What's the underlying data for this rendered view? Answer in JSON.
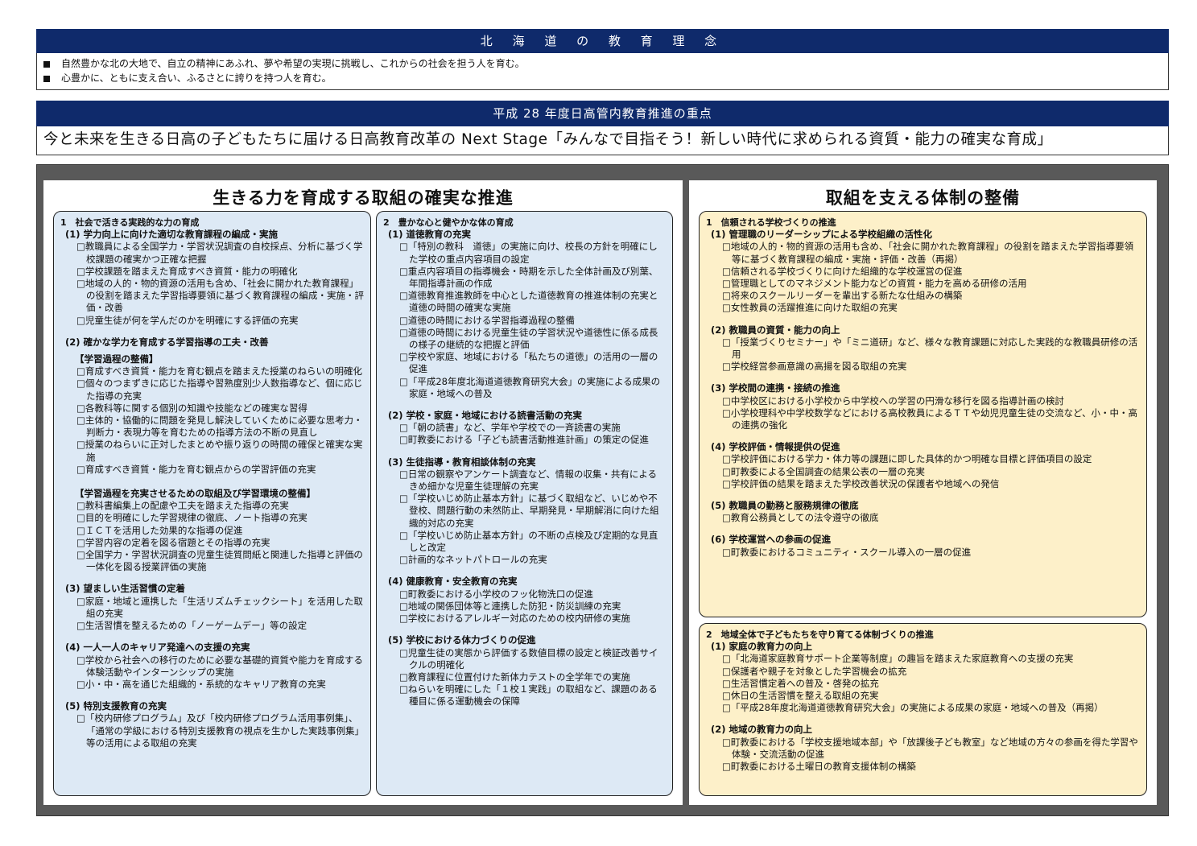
{
  "header": {
    "philosophy_title": "北 海 道 の 教 育 理 念",
    "philosophy_lines": [
      "自然豊かな北の大地で、自立の精神にあふれ、夢や希望の実現に挑戦し、これからの社会を担う人を育む。",
      "心豊かに、ともに支え合い、ふるさとに誇りを持つ人を育む。"
    ],
    "priority_title": "平成 28 年度日高管内教育推進の重点",
    "slogan": "今と未来を生きる日高の子どもたちに届ける日高教育改革の Next Stage「みんなで目指そう！新しい時代に求められる資質・能力の確実な育成」"
  },
  "left_panel": {
    "title": "生きる力を育成する取組の確実な推進",
    "col1": {
      "heading": "1　社会で活きる実践的な力の育成",
      "sections": [
        {
          "title": "(1) 学力向上に向けた適切な教育課程の編成・実施",
          "items": [
            "□教職員による全国学力・学習状況調査の自校採点、分析に基づく学校課題の確実かつ正確な把握",
            "□学校課題を踏まえた育成すべき資質・能力の明確化",
            "□地域の人的・物的資源の活用も含め、「社会に開かれた教育課程」の役割を踏まえた学習指導要領に基づく教育課程の編成・実施・評価・改善",
            "□児童生徒が何を学んだのかを明確にする評価の充実"
          ]
        },
        {
          "title": "(2) 確かな学力を育成する学習指導の工夫・改善",
          "sub": "【学習過程の整備】",
          "items": [
            "□育成すべき資質・能力を育む観点を踏まえた授業のねらいの明確化",
            "□個々のつまずきに応じた指導や習熟度別少人数指導など、個に応じた指導の充実",
            "□各教科等に関する個別の知識や技能などの確実な習得",
            "□主体的・協働的に問題を発見し解決していくために必要な思考力・判断力・表現力等を育むための指導方法の不断の見直し",
            "□授業のねらいに正対したまとめや振り返りの時間の確保と確実な実施",
            "□育成すべき資質・能力を育む観点からの学習評価の充実"
          ],
          "sub2": "【学習過程を充実させるための取組及び学習環境の整備】",
          "items2": [
            "□教科書編集上の配慮や工夫を踏まえた指導の充実",
            "□目的を明確にした学習規律の徹底、ノート指導の充実",
            "□ＩＣＴを活用した効果的な指導の促進",
            "□学習内容の定着を図る宿題とその指導の充実",
            "□全国学力・学習状況調査の児童生徒質問紙と関連した指導と評価の一体化を図る授業評価の実施"
          ]
        },
        {
          "title": "(3) 望ましい生活習慣の定着",
          "items": [
            "□家庭・地域と連携した「生活リズムチェックシート」を活用した取組の充実",
            "□生活習慣を整えるための「ノーゲームデー」等の設定"
          ]
        },
        {
          "title": "(4) 一人一人のキャリア発達への支援の充実",
          "items": [
            "□学校から社会への移行のために必要な基礎的資質や能力を育成する体験活動やインターンシップの実施",
            "□小・中・高を通じた組織的・系統的なキャリア教育の充実"
          ]
        },
        {
          "title": "(5) 特別支援教育の充実",
          "items": [
            "□「校内研修プログラム」及び「校内研修プログラム活用事例集」、「通常の学級における特別支援教育の視点を生かした実践事例集」等の活用による取組の充実"
          ]
        }
      ]
    },
    "col2": {
      "heading": "2　豊かな心と健やかな体の育成",
      "sections": [
        {
          "title": "(1) 道徳教育の充実",
          "items": [
            "□「特別の教科　道徳」の実施に向け、校長の方針を明確にした学校の重点内容項目の設定",
            "□重点内容項目の指導機会・時期を示した全体計画及び別葉、年間指導計画の作成",
            "□道徳教育推進教師を中心とした道徳教育の推進体制の充実と道徳の時間の確実な実施",
            "□道徳の時間における学習指導過程の整備",
            "□道徳の時間における児童生徒の学習状況や道徳性に係る成長の様子の継続的な把握と評価",
            "□学校や家庭、地域における「私たちの道徳」の活用の一層の促進",
            "□「平成28年度北海道道徳教育研究大会」の実施による成果の家庭・地域への普及"
          ]
        },
        {
          "title": "(2) 学校・家庭・地域における読書活動の充実",
          "items": [
            "□「朝の読書」など、学年や学校での一斉読書の実施",
            "□町教委における「子ども読書活動推進計画」の策定の促進"
          ]
        },
        {
          "title": "(3) 生徒指導・教育相談体制の充実",
          "items": [
            "□日常の観察やアンケート調査など、情報の収集・共有によるきめ細かな児童生徒理解の充実",
            "□「学校いじめ防止基本方針」に基づく取組など、いじめや不登校、問題行動の未然防止、早期発見・早期解消に向けた組織的対応の充実",
            "□「学校いじめ防止基本方針」の不断の点検及び定期的な見直しと改定",
            "□計画的なネットパトロールの充実"
          ]
        },
        {
          "title": "(4) 健康教育・安全教育の充実",
          "items": [
            "□町教委における小学校のフッ化物洗口の促進",
            "□地域の関係団体等と連携した防犯・防災訓練の充実",
            "□学校におけるアレルギー対応のための校内研修の実施"
          ]
        },
        {
          "title": "(5) 学校における体力づくりの促進",
          "items": [
            "□児童生徒の実態から評価する数値目標の設定と検証改善サイクルの明確化",
            "□教育課程に位置付けた新体力テストの全学年での実施",
            "□ねらいを明確にした「１校１実践」の取組など、課題のある種目に係る運動機会の保障"
          ]
        }
      ]
    }
  },
  "right_panel": {
    "title": "取組を支える体制の整備",
    "box1": {
      "heading": "1　信頼される学校づくりの推進",
      "sections": [
        {
          "title": "(1) 管理職のリーダーシップによる学校組織の活性化",
          "items": [
            "□地域の人的・物的資源の活用も含め、「社会に開かれた教育課程」の役割を踏まえた学習指導要領等に基づく教育課程の編成・実施・評価・改善（再掲）",
            "□信頼される学校づくりに向けた組織的な学校運営の促進",
            "□管理職としてのマネジメント能力などの資質・能力を高める研修の活用",
            "□将来のスクールリーダーを輩出する新たな仕組みの構築",
            "□女性教員の活躍推進に向けた取組の充実"
          ]
        },
        {
          "title": "(2) 教職員の資質・能力の向上",
          "items": [
            "□「授業づくりセミナー」や「ミニ道研」など、様々な教育課題に対応した実践的な教職員研修の活用",
            "□学校経営参画意識の高揚を図る取組の充実"
          ]
        },
        {
          "title": "(3) 学校間の連携・接続の推進",
          "items": [
            "□中学校区における小学校から中学校への学習の円滑な移行を図る指導計画の検討",
            "□小学校理科や中学校数学などにおける高校教員によるＴＴや幼児児童生徒の交流など、小・中・高の連携の強化"
          ]
        },
        {
          "title": "(4) 学校評価・情報提供の促進",
          "items": [
            "□学校評価における学力・体力等の課題に即した具体的かつ明確な目標と評価項目の設定",
            "□町教委による全国調査の結果公表の一層の充実",
            "□学校評価の結果を踏まえた学校改善状況の保護者や地域への発信"
          ]
        },
        {
          "title": "(5) 教職員の勤務と服務規律の徹底",
          "items": [
            "□教育公務員としての法令遵守の徹底"
          ]
        },
        {
          "title": "(6) 学校運営への参画の促進",
          "items": [
            "□町教委におけるコミュニティ・スクール導入の一層の促進"
          ]
        }
      ]
    },
    "box2": {
      "heading": "2　地域全体で子どもたちを守り育てる体制づくりの推進",
      "sections": [
        {
          "title": "(1) 家庭の教育力の向上",
          "items": [
            "□「北海道家庭教育サポート企業等制度」の趣旨を踏まえた家庭教育への支援の充実",
            "□保護者や親子を対象とした学習機会の拡充",
            "□生活習慣定着への普及・啓発の拡充",
            "□休日の生活習慣を整える取組の充実",
            "□「平成28年度北海道道徳教育研究大会」の実施による成果の家庭・地域への普及（再掲）"
          ]
        },
        {
          "title": "(2) 地域の教育力の向上",
          "items": [
            "□町教委における「学校支援地域本部」や「放課後子ども教室」など地域の方々の参画を得た学習や体験・交流活動の促進",
            "□町教委における土曜日の教育支援体制の構築"
          ]
        }
      ]
    }
  },
  "colors": {
    "band": "#0f2a6b",
    "frame": "#595959",
    "blue_box": "#dde9f5",
    "yellow_box": "#fdf0c9"
  }
}
